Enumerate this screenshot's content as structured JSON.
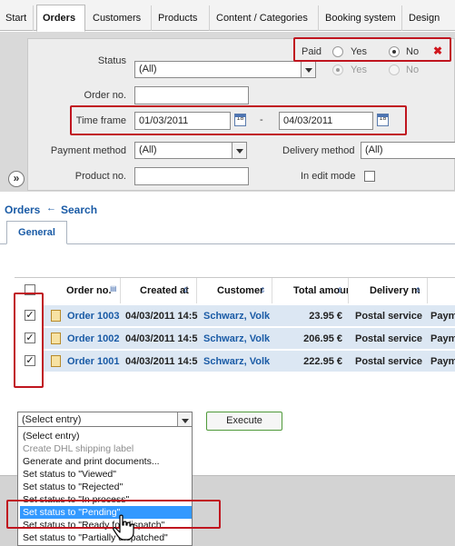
{
  "nav": {
    "tabs": [
      "Start",
      "Orders",
      "Customers",
      "Products",
      "Content / Categories",
      "Booking system",
      "Design"
    ]
  },
  "filters": {
    "status_label": "Status",
    "status_value": "(All)",
    "paid_label": "Paid",
    "yes": "Yes",
    "no": "No",
    "order_no_label": "Order no.",
    "order_no_value": "",
    "time_frame_label": "Time frame",
    "date_from": "01/03/2011",
    "date_to": "04/03/2011",
    "date_separator": "-",
    "calendar_glyph": "18",
    "payment_method_label": "Payment method",
    "payment_method_value": "(All)",
    "delivery_method_label": "Delivery method",
    "delivery_method_value": "(All)",
    "product_no_label": "Product no.",
    "product_no_value": "",
    "edit_mode_label": "In edit mode",
    "expand_glyph": "»",
    "clear_glyph": "✖"
  },
  "breadcrumb": {
    "orders": "Orders",
    "arrow": "←",
    "search": "Search"
  },
  "subtabs": [
    "General"
  ],
  "grid": {
    "headers": [
      "Order no.",
      "Created at",
      "Customer",
      "Total amount",
      "Delivery m"
    ],
    "rows": [
      {
        "order": "Order 1003",
        "created": "04/03/2011 14:5",
        "customer": "Schwarz, Volk",
        "total": "23.95 €",
        "delivery": "Postal service",
        "payment": "Paym"
      },
      {
        "order": "Order 1002",
        "created": "04/03/2011 14:5",
        "customer": "Schwarz, Volk",
        "total": "206.95 €",
        "delivery": "Postal service",
        "payment": "Paym"
      },
      {
        "order": "Order 1001",
        "created": "04/03/2011 14:5",
        "customer": "Schwarz, Volk",
        "total": "222.95 €",
        "delivery": "Postal service",
        "payment": "Paym"
      }
    ],
    "check": "✓"
  },
  "actions": {
    "select_value": "(Select entry)",
    "execute_label": "Execute",
    "options": [
      "(Select entry)",
      "Create DHL shipping label",
      "Generate and print documents...",
      "Set status to \"Viewed\"",
      "Set status to \"Rejected\"",
      "Set status to \"In process\"",
      "Set status to \"Pending\"",
      "Set status to \"Ready for dispatch\"",
      "Set status to \"Partially dispatched\""
    ],
    "selected_index": 6
  },
  "colors": {
    "accent": "#1a5ba6",
    "highlight": "#c0151f",
    "selection": "#3399ff"
  }
}
